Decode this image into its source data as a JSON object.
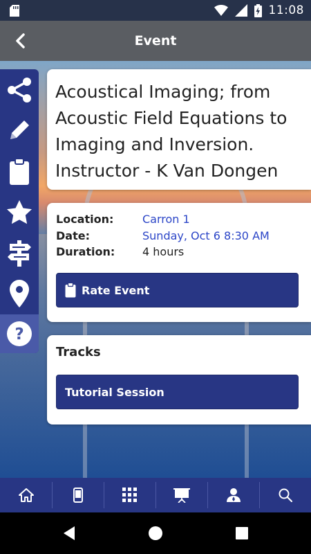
{
  "status_bar": {
    "time": "11:08"
  },
  "app_bar": {
    "title": "Event"
  },
  "event": {
    "title": "Acoustical Imaging; from Acoustic Field Equations to Imaging and Inversion. Instructor - K Van Dongen",
    "location_label": "Location:",
    "location_value": "Carron 1",
    "date_label": "Date:",
    "date_value": "Sunday, Oct 6 8:30 AM",
    "duration_label": "Duration:",
    "duration_value": "4 hours",
    "rate_label": "Rate Event"
  },
  "tracks": {
    "heading": "Tracks",
    "items": [
      "Tutorial Session"
    ]
  },
  "side_rail": {
    "icons": [
      "share-icon",
      "pencil-icon",
      "clipboard-icon",
      "star-icon",
      "signpost-icon",
      "map-pin-icon",
      "help-icon"
    ]
  },
  "tab_bar": {
    "icons": [
      "home-icon",
      "mobile-icon",
      "grid-icon",
      "presentation-icon",
      "attendee-icon",
      "search-icon"
    ]
  },
  "colors": {
    "primary": "#283684",
    "app_bar": "#5a5d62",
    "link": "#2b45c7"
  }
}
